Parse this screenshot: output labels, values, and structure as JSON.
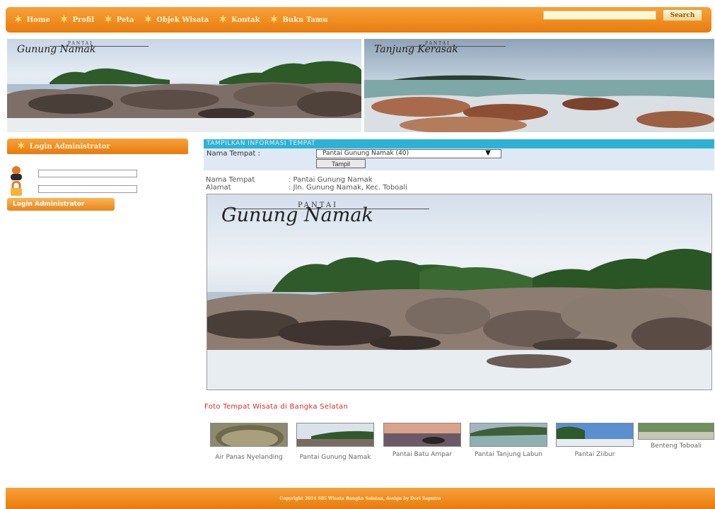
{
  "nav": {
    "items": [
      {
        "label": "Home"
      },
      {
        "label": "Profil"
      },
      {
        "label": "Peta"
      },
      {
        "label": "Objek Wisata"
      },
      {
        "label": "Kontak"
      },
      {
        "label": "Buku Tamu"
      }
    ],
    "search_placeholder": "",
    "search_label": "Search"
  },
  "banners": {
    "left": {
      "small": "PANTAI",
      "big": "Gunung Namak"
    },
    "right": {
      "small": "PANTAI",
      "big": "Tanjung Kerasak"
    }
  },
  "sidebar": {
    "title": "Login Administrator",
    "login_button": "Login Administrator"
  },
  "main": {
    "header": "TAMPILKAN INFORMASI TEMPAT",
    "form_label": "Nama Tempat :",
    "selected_place": "Pantai Gunung Namak (40)",
    "show_button": "Tampil",
    "detail": {
      "name_label": "Nama Tempat",
      "name_value": ": Pantai Gunung Namak",
      "address_label": "Alamat",
      "address_value": ": Jln. Gunung Namak, Kec. Toboali"
    },
    "photo": {
      "small": "PANTAI",
      "big": "Gunung Namak"
    }
  },
  "gallery": {
    "title": "Foto Tempat Wisata di Bangka Selatan",
    "items": [
      {
        "label": "Air Panas Nyelanding"
      },
      {
        "label": "Pantai Gunung Namak"
      },
      {
        "label": "Pantai Batu Ampar"
      },
      {
        "label": "Pantai Tanjung Labun"
      },
      {
        "label": "Pantai Ziibur"
      },
      {
        "label": "Benteng Toboali"
      }
    ]
  },
  "footer": {
    "text": "Copyright 2014 SIG Wisata Bangka Selatan, design by Dori Saputra"
  },
  "colors": {
    "accent": "#ea7b0c",
    "info_header": "#2db2d6",
    "gallery_title": "#d62b2b"
  }
}
